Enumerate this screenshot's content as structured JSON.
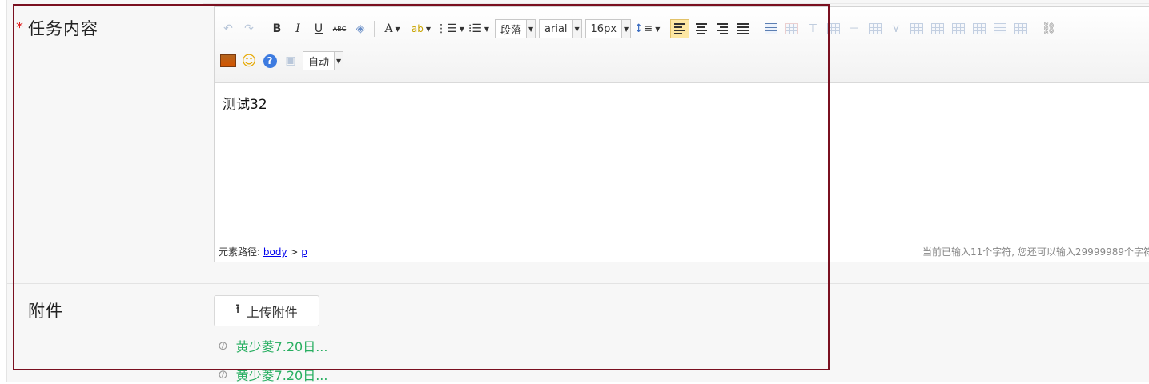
{
  "form": {
    "content_label": "任务内容",
    "required_mark": "*",
    "attach_label": "附件"
  },
  "editor": {
    "toolbar": {
      "paragraph_select": "段落",
      "font_select": "arial",
      "size_select": "16px",
      "auto_select": "自动",
      "bold": "B",
      "italic": "I",
      "underline": "U",
      "strikethrough": "ABC",
      "font_color": "A"
    },
    "content": "测试32",
    "status": {
      "path_label": "元素路径:",
      "path_body": "body",
      "path_sep": ">",
      "path_p": "p",
      "word_count": "当前已输入11个字符, 您还可以输入29999989个字符"
    }
  },
  "attachments": {
    "upload_label": "上传附件",
    "items": [
      "黄少菱7.20日...",
      "黄少菱7.20日..."
    ]
  },
  "colors": {
    "highlight_border": "#7a1020",
    "attachment_link": "#27ae60",
    "required": "#e02020"
  }
}
